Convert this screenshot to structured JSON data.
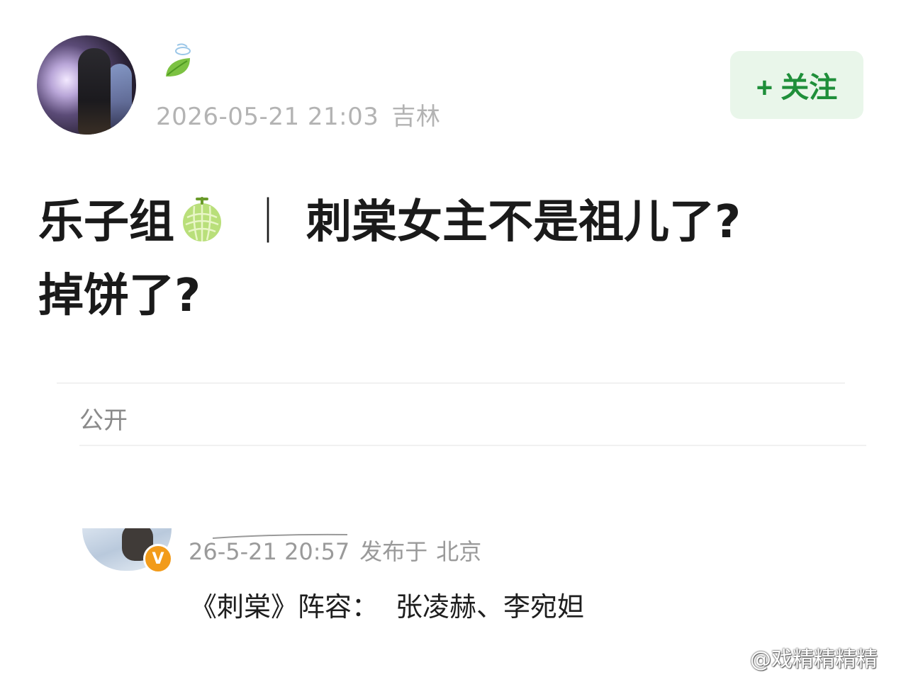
{
  "post": {
    "timestamp": "2026-05-21 21:03",
    "location": "吉林",
    "follow_label": "+ 关注",
    "title_prefix": "乐子组",
    "title_separator": "｜",
    "title_line1": "刺棠女主不是祖儿了?",
    "title_line2": "掉饼了?",
    "visibility": "公开"
  },
  "comment": {
    "timestamp": "26-5-21 20:57",
    "published_label": "发布于",
    "location": "北京",
    "work": "《刺棠》阵容：",
    "cast": "张凌赫、李宛妲",
    "badge": "V"
  },
  "watermark": {
    "text": "@戏精精精精"
  },
  "colors": {
    "follow_bg": "#e9f6ea",
    "follow_text": "#1f8f3a",
    "meta_gray": "#b3b3b3",
    "badge_orange": "#f29b1a"
  },
  "icons": {
    "leaf": "leaf-icon",
    "melon": "melon-icon",
    "weibo": "weibo-logo-icon"
  }
}
